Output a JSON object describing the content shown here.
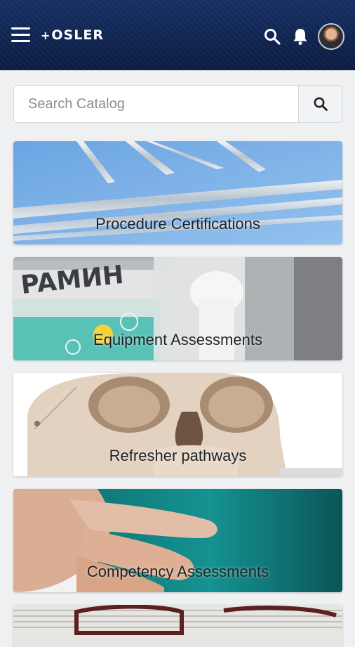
{
  "header": {
    "brand": "OSLER",
    "brand_mark": "+",
    "menu_icon": "menu-icon",
    "search_icon": "search-icon",
    "bell_icon": "bell-icon",
    "avatar_icon": "user-avatar"
  },
  "search": {
    "placeholder": "Search Catalog",
    "value": "",
    "button_icon": "search-icon"
  },
  "catalog": {
    "categories": [
      {
        "label": "Procedure Certifications",
        "image": "surgical-instruments"
      },
      {
        "label": "Equipment Assessments",
        "image": "medical-equipment"
      },
      {
        "label": "Refresher pathways",
        "image": "skull-model"
      },
      {
        "label": "Competency Assessments",
        "image": "hand-on-teal"
      },
      {
        "label": "",
        "image": "glasses-on-newspaper"
      }
    ]
  },
  "colors": {
    "header_bg": "#0f2450",
    "page_bg": "#eef0f2",
    "card_text": "#1f2226"
  }
}
